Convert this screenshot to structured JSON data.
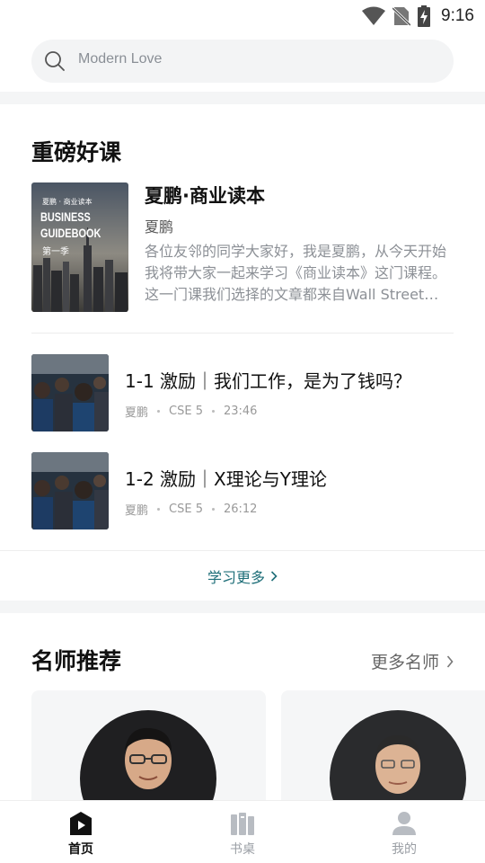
{
  "status_bar": {
    "time": "9:16"
  },
  "search": {
    "placeholder": "Modern Love"
  },
  "featured": {
    "title": "重磅好课",
    "book": {
      "title": "夏鹏·商业读本",
      "author": "夏鹏",
      "description": "各位友邻的同学大家好，我是夏鹏，从今天开始我将带大家一起来学习《商业读本》这门课程。这一门课我们选择的文章都来自Wall Street Journal",
      "cover": {
        "line1": "夏鹏 · 商业读本",
        "line2": "BUSINESS",
        "line3": "GUIDEBOOK",
        "line4": "第一季"
      }
    },
    "lessons": [
      {
        "title": "1-1 激励｜我们工作，是为了钱吗？",
        "teacher": "夏鹏",
        "level": "CSE 5",
        "duration": "23:46"
      },
      {
        "title": "1-2 激励｜X理论与Y理论",
        "teacher": "夏鹏",
        "level": "CSE 5",
        "duration": "26:12"
      }
    ],
    "learn_more": "学习更多"
  },
  "teachers": {
    "title": "名师推荐",
    "more": "更多名师"
  },
  "tabbar": {
    "items": [
      {
        "label": "首页",
        "icon": "play-icon",
        "active": true
      },
      {
        "label": "书桌",
        "icon": "books-icon",
        "active": false
      },
      {
        "label": "我的",
        "icon": "person-icon",
        "active": false
      }
    ]
  },
  "colors": {
    "accent": "#1e6e78",
    "inactive_tab": "#b8bcc2",
    "active_tab": "#111111"
  }
}
